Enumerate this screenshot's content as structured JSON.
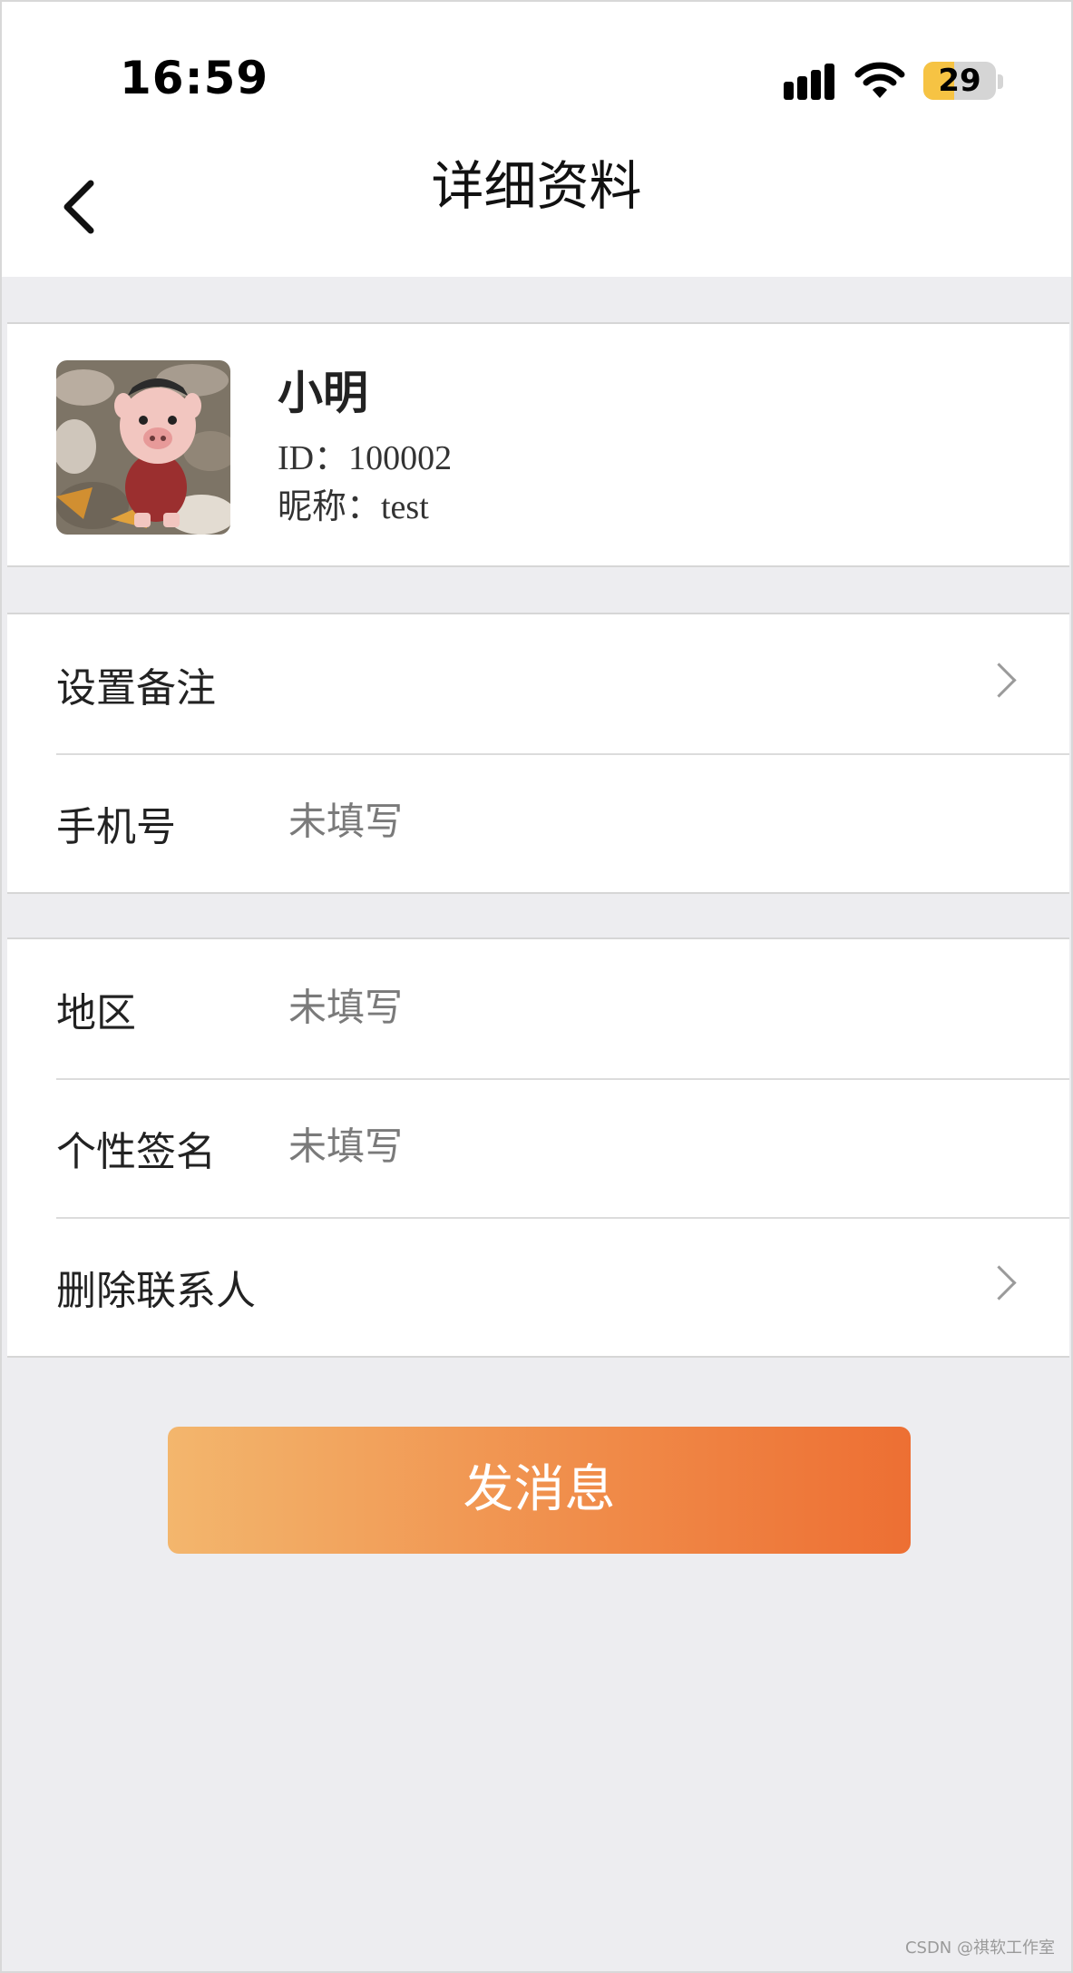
{
  "status_bar": {
    "time": "16:59",
    "battery": "29"
  },
  "nav": {
    "title": "详细资料"
  },
  "profile": {
    "name": "小明",
    "id_line": "ID：100002",
    "nickname_line": "昵称：test"
  },
  "rows": {
    "remark": {
      "label": "设置备注"
    },
    "phone": {
      "label": "手机号",
      "value": "未填写"
    },
    "region": {
      "label": "地区",
      "value": "未填写"
    },
    "signature": {
      "label": "个性签名",
      "value": "未填写"
    },
    "delete": {
      "label": "删除联系人"
    }
  },
  "actions": {
    "send_message": "发消息"
  },
  "watermark": "CSDN @祺软工作室",
  "colors": {
    "button_start": "#f3b66d",
    "button_end": "#ed6f33",
    "background": "#ededf0"
  }
}
